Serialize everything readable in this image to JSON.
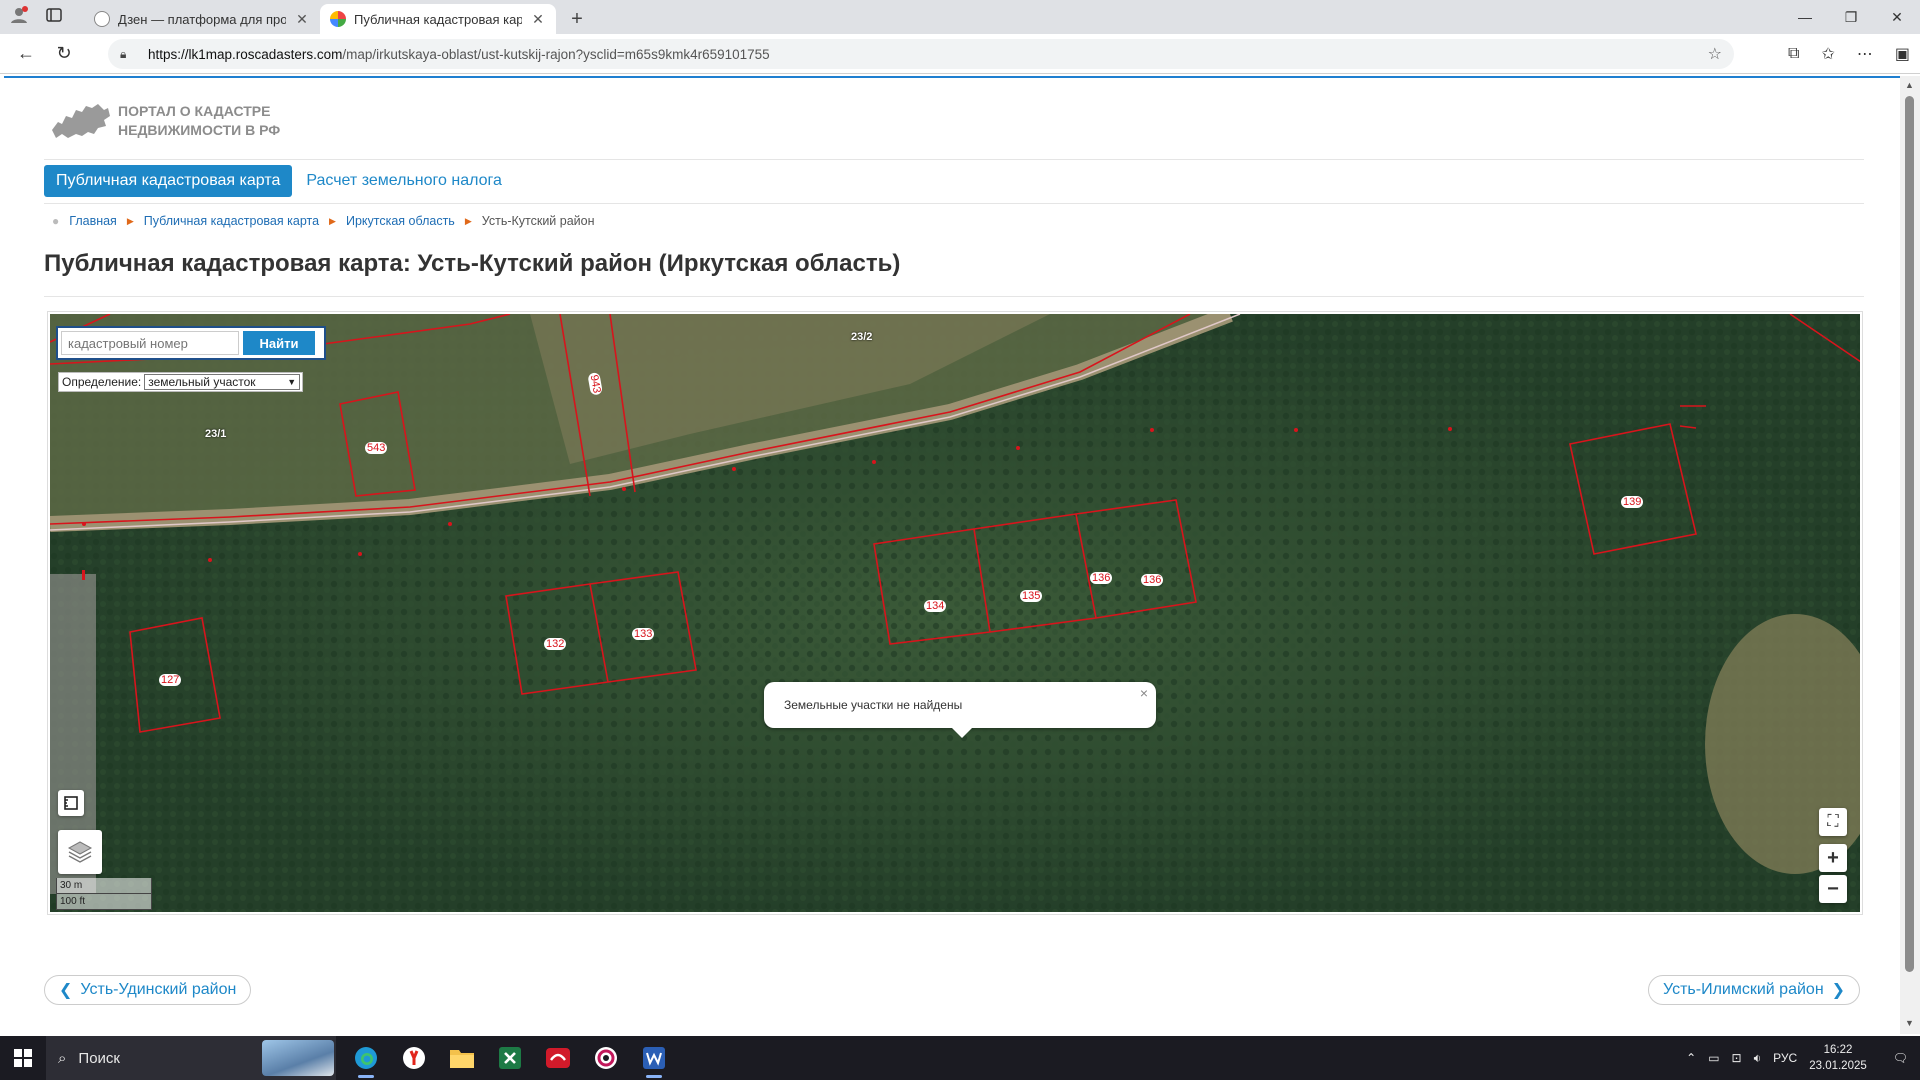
{
  "browser": {
    "tabs": [
      {
        "title": "Дзен — платформа для просмотра",
        "active": false
      },
      {
        "title": "Публичная кадастровая карта: Усть",
        "active": true
      }
    ],
    "url_host": "https://lk1map.roscadasters.com",
    "url_path": "/map/irkutskaya-oblast/ust-kutskij-rajon?ysclid=m65s9kmk4r659101755"
  },
  "site": {
    "logo_line1": "ПОРТАЛ О КАДАСТРЕ",
    "logo_line2": "НЕДВИЖИМОСТИ В РФ",
    "nav": {
      "active": "Публичная кадастровая карта",
      "link": "Расчет земельного налога"
    },
    "breadcrumb": [
      "Главная",
      "Публичная кадастровая карта",
      "Иркутская область",
      "Усть-Кутский район"
    ],
    "title": "Публичная кадастровая карта: Усть-Кутский район (Иркутская область)"
  },
  "map": {
    "search_placeholder": "кадастровый номер",
    "search_button": "Найти",
    "definition_label": "Определение:",
    "definition_value": "земельный участок",
    "popup_text": "Земельные участки не найдены",
    "scale_top": "30 m",
    "scale_bottom": "100 ft",
    "parcels": [
      "23/2",
      "23/1",
      "543",
      "943",
      "139",
      "134",
      "135",
      "136",
      "136",
      "132",
      "133",
      "127"
    ],
    "colors": {
      "boundary": "#d8141c",
      "forest": "#24432b",
      "road": "#8a8466"
    }
  },
  "pager": {
    "prev": "Усть-Удинский район",
    "next": "Усть-Илимский район"
  },
  "taskbar": {
    "search_label": "Поиск",
    "lang": "РУС",
    "time": "16:22",
    "date": "23.01.2025"
  }
}
